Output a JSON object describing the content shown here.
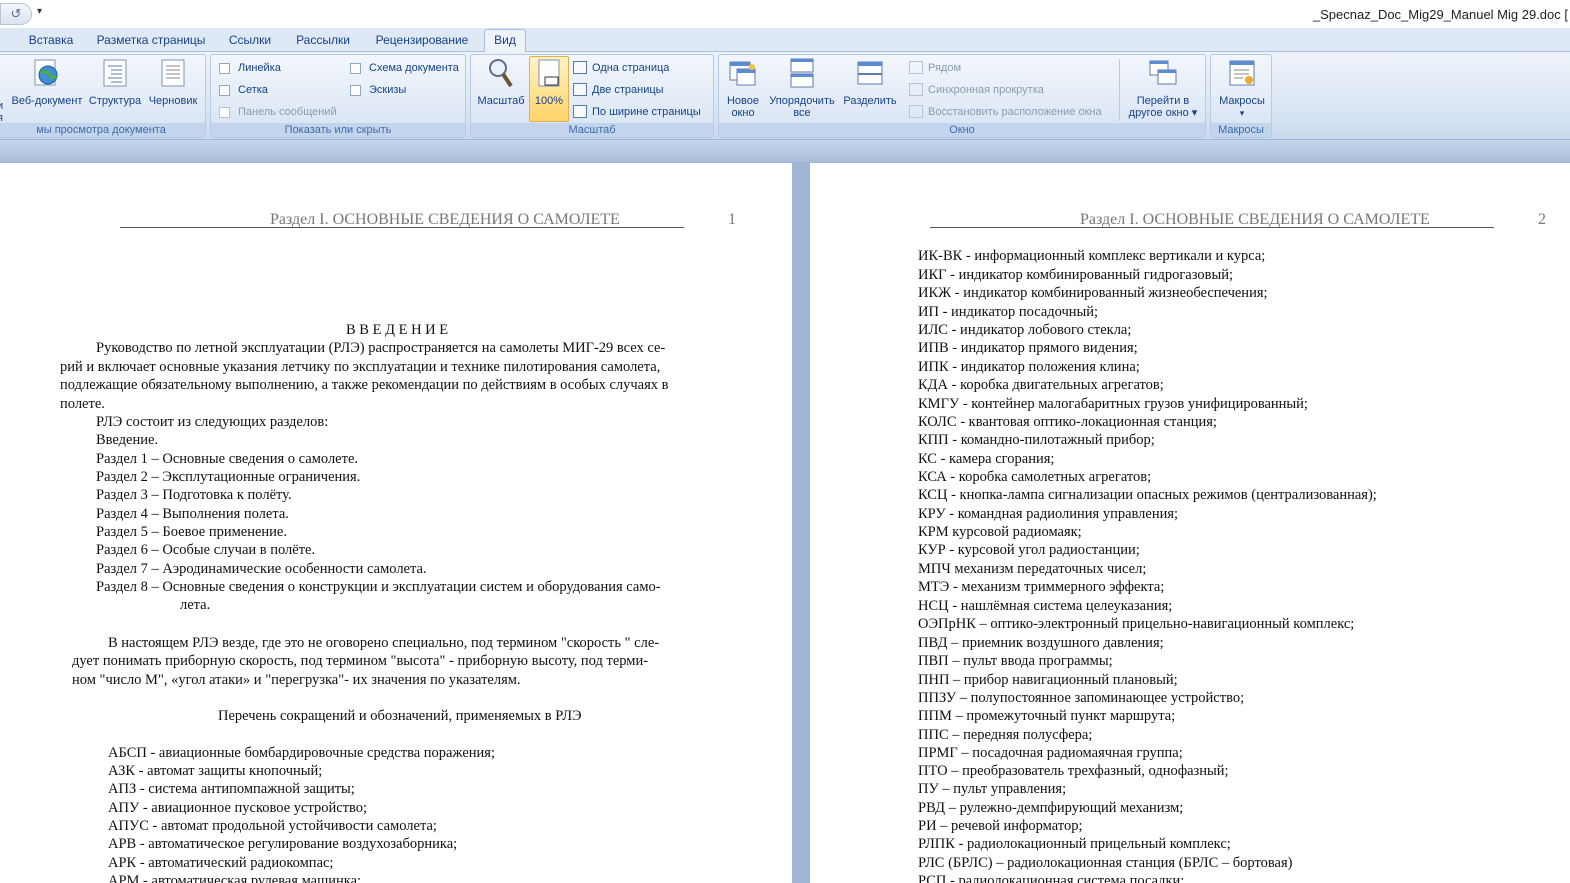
{
  "titlebar": {
    "title": "_Specnaz_Doc_Mig29_Manuel Mig 29.doc [",
    "undo_glyph": "↺",
    "dropdown_glyph": "▾"
  },
  "tabs": [
    "Вставка",
    "Разметка страницы",
    "Ссылки",
    "Рассылки",
    "Рецензирование",
    "Вид"
  ],
  "ribbon": {
    "views_group": {
      "label": "мы просмотра документа",
      "partial_label": "и",
      "partial_label2": "я",
      "web_doc": "Веб-документ",
      "structure": "Структура",
      "draft": "Черновик"
    },
    "show_group": {
      "label": "Показать или скрыть",
      "ruler": "Линейка",
      "grid": "Сетка",
      "msg_panel": "Панель сообщений",
      "doc_map": "Схема документа",
      "thumbnails": "Эскизы"
    },
    "zoom_group": {
      "label": "Масштаб",
      "zoom": "Масштаб",
      "hundred": "100%",
      "one_page": "Одна страница",
      "two_pages": "Две страницы",
      "page_width": "По ширине страницы"
    },
    "window_group": {
      "label": "Окно",
      "new_window_1": "Новое",
      "new_window_2": "окно",
      "arrange_1": "Упорядочить",
      "arrange_2": "все",
      "split": "Разделить",
      "side_by_side": "Рядом",
      "sync_scroll": "Синхронная прокрутка",
      "reset_pos": "Восстановить расположение окна",
      "switch_1": "Перейти в",
      "switch_2": "другое окно ▾"
    },
    "macros_group": {
      "label": "Макросы",
      "macros": "Макросы",
      "arrow": "▾"
    }
  },
  "page1": {
    "header": "Раздел I. ОСНОВНЫЕ СВЕДЕНИЯ О САМОЛЕТЕ",
    "page_number": "1",
    "lines": [
      "В В Е Д Е Н И Е",
      "Руководство по летной эксплуатации (РЛЭ) распространяется на самолеты МИГ-29 всех се-",
      "рий и включает основные указания летчику по эксплуатации и технике пилотирования самолета,",
      "подлежащие обязательному выполнению, а также рекомендации по действиям в особых случаях в",
      "полете.",
      "РЛЭ состоит из следующих разделов:",
      "Введение.",
      "Раздел 1 – Основные сведения о самолете.",
      "Раздел 2 – Эксплутационные ограничения.",
      "Раздел 3 – Подготовка к полёту.",
      "Раздел 4 – Выполнения полета.",
      "Раздел 5 – Боевое применение.",
      "Раздел 6 – Особые случаи в полёте.",
      "Раздел 7 – Аэродинамические особенности самолета.",
      "Раздел 8 – Основные сведения о конструкции и эксплуатации систем и оборудования само-",
      "лета.",
      "В настоящем РЛЭ везде, где это не оговорено специально, под термином \"скорость \" сле-",
      "дует понимать приборную скорость, под термином \"высота\" - приборную высоту, под терми-",
      "ном \"число М\", «угол атаки» и \"перегрузка\"- их значения по указателям.",
      "Перечень сокращений и обозначений, применяемых в РЛЭ",
      "АБСП - авиационные бомбардировочные средства поражения;",
      "АЗК  - автомат защиты  кнопочный;",
      "АПЗ  - система  антипомпажной защиты;",
      "АПУ  - авиационное пусковое устройство;",
      "АПУС - автомат продольной устойчивости самолета;",
      "АРВ   - автоматическое регулирование воздухозаборника;",
      "АРК  - автоматический радиокомпас;",
      "АРМ  - автоматическая рулевая машинка;"
    ]
  },
  "page2": {
    "header": "Раздел I. ОСНОВНЫЕ СВЕДЕНИЯ О САМОЛЕТЕ",
    "page_number": "2",
    "lines": [
      "ИК-ВК  - информационный комплекс вертикали и курса;",
      "ИКГ  - индикатор комбинированный гидрогазовый;",
      "ИКЖ  - индикатор комбинированный жизнеобеспечения;",
      "ИП   - индикатор посадочный;",
      "ИЛС  - индикатор лобового стекла;",
      "ИПВ  - индикатор прямого видения;",
      "ИПК  - индикатор положения клина;",
      "КДА  - коробка двигательных агрегатов;",
      "КМГУ  - контейнер малогабаритных грузов унифицированный;",
      "КОЛС  - квантовая оптико-локационная станция;",
      "КПП  - командно-пилотажный прибор;",
      "КС  - камера сгорания;",
      "КСА  - коробка самолетных агрегатов;",
      "КСЦ  - кнопка-лампа сигнализации опасных режимов (централизованная);",
      "КРУ  - командная радиолиния управления;",
      "КРМ  курсовой радиомаяк;",
      "КУР  - курсовой угол радиостанции;",
      "МПЧ  механизм передаточных чисел;",
      "МТЭ  - механизм триммерного эффекта;",
      "НСЦ  - нашлёмная система  целеуказания;",
      "ОЭПрНК – оптико-электронный прицельно-навигационный комплекс;",
      "ПВД – приемник воздушного давления;",
      "ПВП – пульт ввода программы;",
      "ПНП – прибор навигационный плановый;",
      "ППЗУ – полупостоянное запоминающее устройство;",
      "ППМ – промежуточный пункт маршрута;",
      "ППС – передняя полусфера;",
      "ПРМГ – посадочная радиомаячная группа;",
      "ПТО – преобразователь трехфазный, однофазный;",
      "ПУ – пульт управления;",
      "РВД – рулежно-демпфирующий механизм;",
      "РИ – речевой информатор;",
      "РЛПК  - радиолокационный прицельный комплекс;",
      "РЛС (БРЛС) – радиолокационная станция (БРЛС – бортовая)",
      "РСП  - радиолокационная система посадки;"
    ]
  }
}
